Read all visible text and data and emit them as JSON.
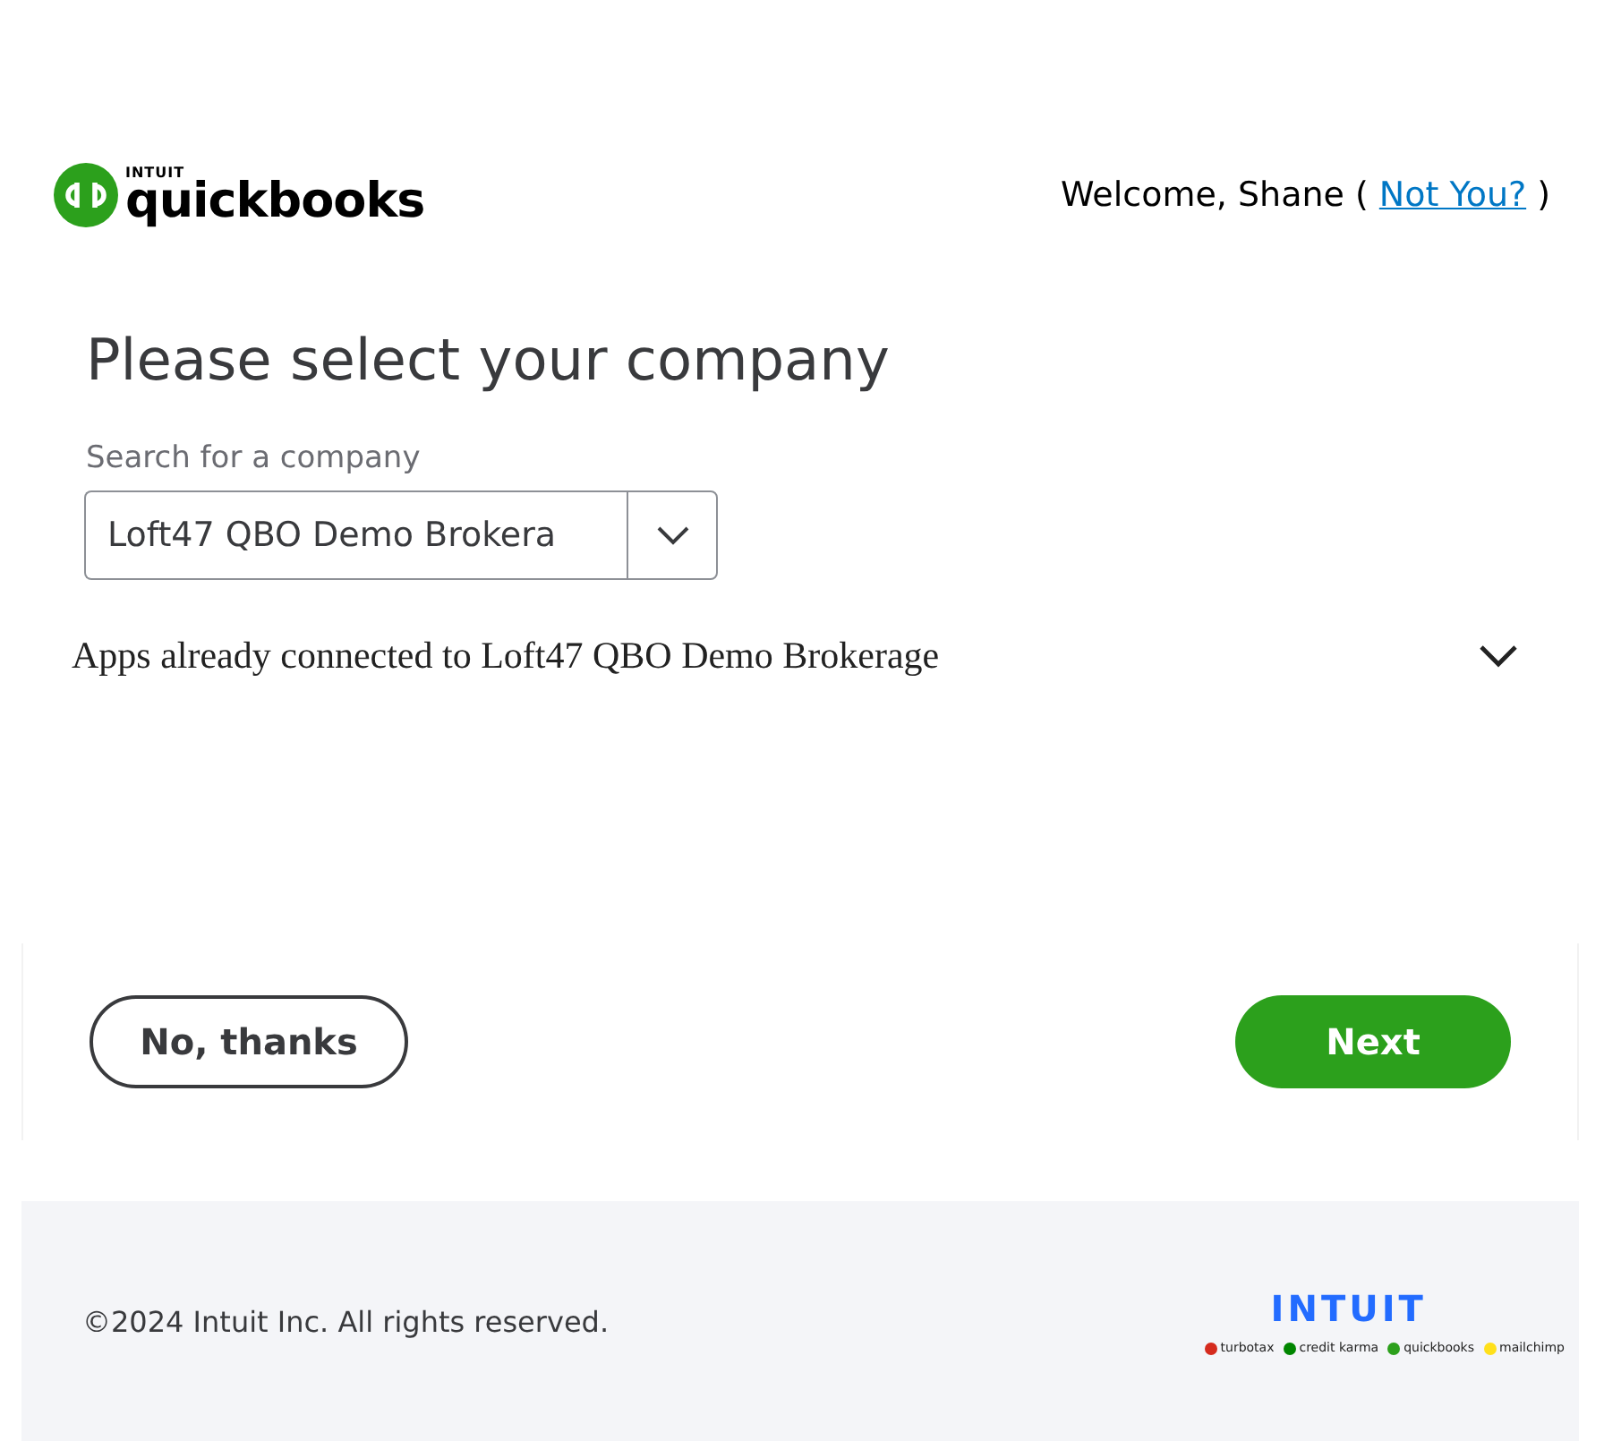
{
  "header": {
    "logo": {
      "brand": "INTUIT",
      "product": "quickbooks"
    },
    "welcome": "Welcome, Shane (",
    "link": "Not You?",
    "close_paren": ")"
  },
  "title": "Please select your company",
  "search": {
    "label": "Search for a company",
    "value": "Loft47 QBO Demo Brokera"
  },
  "apps_section": {
    "text": "Apps already connected to Loft47 QBO Demo Brokerage",
    "expanded": false
  },
  "buttons": [
    {
      "label": "No, thanks",
      "kind": "secondary"
    },
    {
      "label": "Next",
      "kind": "primary"
    }
  ],
  "footer": {
    "copyright": "©2024 Intuit Inc. All rights reserved.",
    "brand": "INTUIT",
    "products": [
      {
        "name": "turbotax",
        "color": "#d52b1e"
      },
      {
        "name": "credit karma",
        "color": "#008600"
      },
      {
        "name": "quickbooks",
        "color": "#2ca01c"
      },
      {
        "name": "mailchimp",
        "color": "#ffe01b"
      }
    ]
  }
}
